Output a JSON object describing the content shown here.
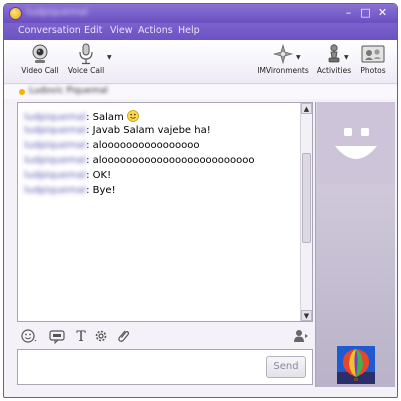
{
  "window": {
    "title": "ludpiquemal",
    "controls": {
      "minimize": "–",
      "maximize": "□",
      "close": "✕"
    }
  },
  "menu": [
    "Conversation",
    "Edit",
    "View",
    "Actions",
    "Help"
  ],
  "toolbar": {
    "video_call": "Video Call",
    "voice_call": "Voice Call",
    "imvironments": "IMVironments",
    "activities": "Activities",
    "photos": "Photos"
  },
  "contact": {
    "status_name": "Ludovic Piquemal"
  },
  "messages": [
    {
      "user": "ludpiquemal",
      "text": "Salam",
      "emoticon": "smiley"
    },
    {
      "user": "ludpiquemal",
      "text": "Javab Salam vajebe ha!"
    },
    {
      "user": "ludpiquemal",
      "text": "aloooooooooooooooo"
    },
    {
      "user": "ludpiquemal",
      "text": "alooooooooooooooooooooooooo"
    },
    {
      "user": "ludpiquemal",
      "text": "OK!"
    },
    {
      "user": "ludpiquemal",
      "text": "Bye!"
    }
  ],
  "input": {
    "send_label": "Send",
    "value": ""
  },
  "icons": {
    "emoticons": "emoticon-icon",
    "audibles": "audible-icon",
    "text_format": "text-format-icon",
    "settings": "gear-icon",
    "attach": "paperclip-icon",
    "contact": "contact-icon"
  },
  "colors": {
    "titlebar": "#6a4fc0",
    "menubar": "#7b62cd",
    "accent": "#f2b400"
  }
}
